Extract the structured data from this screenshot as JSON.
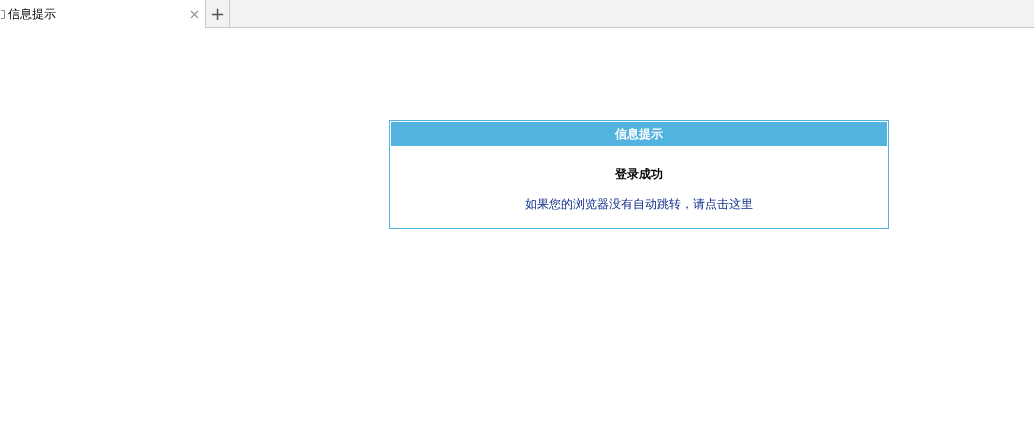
{
  "tabs": [
    {
      "label": "信息提示",
      "selected": true
    }
  ],
  "new_tab": "+",
  "dialog": {
    "title": "信息提示",
    "heading": "登录成功",
    "message": "如果您的浏览器没有自动跳转，请点击这里"
  }
}
